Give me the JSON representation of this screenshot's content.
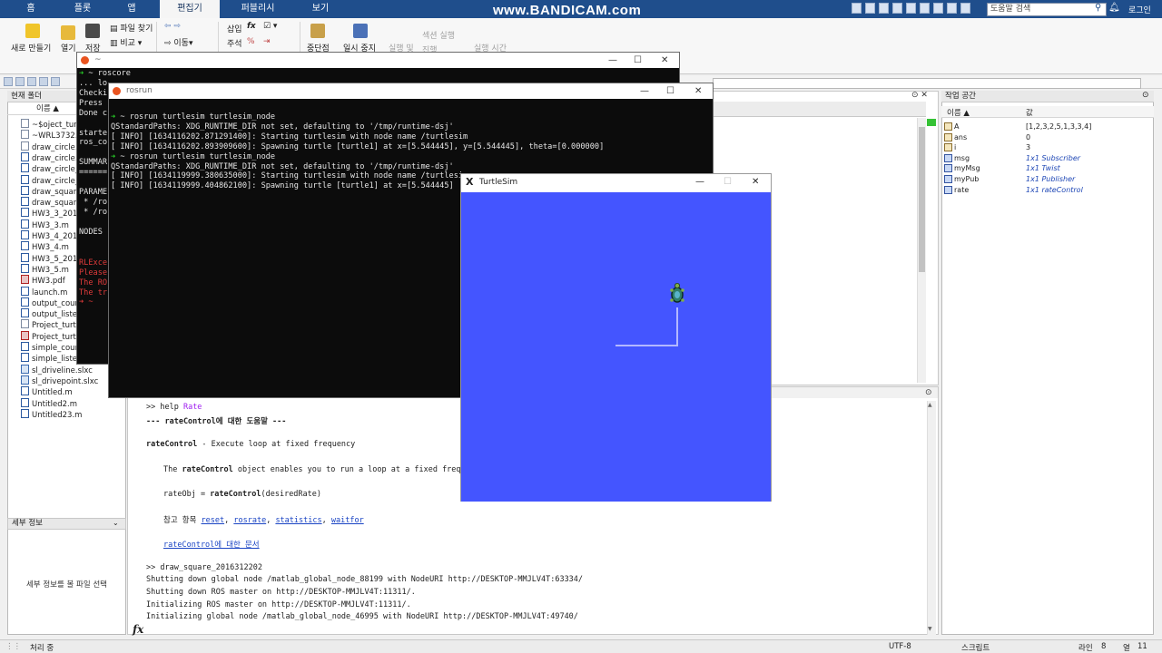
{
  "matlab": {
    "tabs": [
      "홈",
      "플롯",
      "앱",
      "편집기",
      "퍼블리시",
      "보기"
    ],
    "active_tab": "편집기",
    "search_placeholder": "도움말 검색",
    "login": "로그인",
    "ribbon": {
      "new": "새로 만들기",
      "open": "열기",
      "save": "저장",
      "find_files": "파일 찾기",
      "compare": "비교",
      "go": "이동",
      "insert": "삽입",
      "comment": "주석",
      "breakpoint": "중단점",
      "pause": "일시 중지",
      "run_and": "실행 및",
      "run_section": "섹션 실행",
      "step": "진행",
      "run_time": "실행 시간"
    },
    "current_folder": {
      "title": "현재 폴더",
      "col_name": "이름 ▲",
      "files": [
        {
          "name": "~$oject_turtle",
          "type": "doc"
        },
        {
          "name": "~WRL3732.tmp",
          "type": "doc"
        },
        {
          "name": "draw_circle.asv",
          "type": "doc"
        },
        {
          "name": "draw_circle.m",
          "type": "m"
        },
        {
          "name": "draw_circle_v",
          "type": "m"
        },
        {
          "name": "draw_circle_v",
          "type": "m"
        },
        {
          "name": "draw_square",
          "type": "m"
        },
        {
          "name": "draw_square",
          "type": "m"
        },
        {
          "name": "HW3_3_2016",
          "type": "m"
        },
        {
          "name": "HW3_3.m",
          "type": "m"
        },
        {
          "name": "HW3_4_2016",
          "type": "m"
        },
        {
          "name": "HW3_4.m",
          "type": "m"
        },
        {
          "name": "HW3_5_2016",
          "type": "m"
        },
        {
          "name": "HW3_5.m",
          "type": "m"
        },
        {
          "name": "HW3.pdf",
          "type": "pdf"
        },
        {
          "name": "launch.m",
          "type": "m"
        },
        {
          "name": "output_count",
          "type": "m"
        },
        {
          "name": "output_listen",
          "type": "m"
        },
        {
          "name": "Project_turtle",
          "type": "doc"
        },
        {
          "name": "Project_turtle",
          "type": "pdf"
        },
        {
          "name": "simple_count",
          "type": "m"
        },
        {
          "name": "simple_listen",
          "type": "m"
        },
        {
          "name": "sl_driveline.slxc",
          "type": "slx"
        },
        {
          "name": "sl_drivepoint.slxc",
          "type": "slx"
        },
        {
          "name": "Untitled.m",
          "type": "m"
        },
        {
          "name": "Untitled2.m",
          "type": "m"
        },
        {
          "name": "Untitled23.m",
          "type": "m"
        }
      ]
    },
    "details": {
      "title": "세부 정보",
      "hint": "세부 정보를 볼 파일 선택"
    },
    "command_window": {
      "l1_prompt": ">> help ",
      "l1_arg": "Rate",
      "l2": "--- rateControl에 대한 도움말 ---",
      "l3_bold": "rateControl",
      "l3_rest": " - Execute loop at fixed frequency",
      "l4_pre": "The ",
      "l4_bold": "rateControl",
      "l4_rest": " object enables you to run a loop at a fixed frequenc",
      "l5_pre": "rateObj = ",
      "l5_bold": "rateControl",
      "l5_rest": "(desiredRate)",
      "l6_pre": "참고 항목 ",
      "l6_links": [
        "reset",
        "rosrate",
        "statistics",
        "waitfor"
      ],
      "l7_link": "rateControl에 대한 문서",
      "l8": ">> draw_square_2016312202",
      "l9": "Shutting down global node /matlab_global_node_88199 with NodeURI http://DESKTOP-MMJLV4T:63334/",
      "l10": "Shutting down ROS master on http://DESKTOP-MMJLV4T:11311/.",
      "l11": "Initializing ROS master on http://DESKTOP-MMJLV4T:11311/.",
      "l12": "Initializing global node /matlab_global_node_46995 with NodeURI http://DESKTOP-MMJLV4T:49740/",
      "fx": "fx"
    },
    "workspace": {
      "title": "작업 공간",
      "col_name": "이름 ▲",
      "col_value": "값",
      "vars": [
        {
          "name": "A",
          "value": "[1,2,3,2,5,1,3,3,4]",
          "kind": "num"
        },
        {
          "name": "ans",
          "value": "0",
          "kind": "num"
        },
        {
          "name": "i",
          "value": "3",
          "kind": "num"
        },
        {
          "name": "msg",
          "value": "1x1 Subscriber",
          "kind": "obj"
        },
        {
          "name": "myMsg",
          "value": "1x1 Twist",
          "kind": "obj"
        },
        {
          "name": "myPub",
          "value": "1x1 Publisher",
          "kind": "obj"
        },
        {
          "name": "rate",
          "value": "1x1 rateControl",
          "kind": "obj"
        }
      ]
    },
    "status": {
      "left": "처리 중",
      "encoding": "UTF-8",
      "type": "스크립트",
      "line_label": "라인",
      "line": "8",
      "col_label": "열",
      "col": "11"
    }
  },
  "watermark": "www.BANDICAM.com",
  "terminal_roscore": {
    "title": "~",
    "prompt_sym": "➜",
    "cmd": " ~ roscore",
    "lines": [
      "... lo",
      "Checki",
      "Press ",
      "Done c",
      "",
      "starte",
      "ros_co",
      "",
      "SUMMAR",
      "======",
      "",
      "PARAME",
      " * /ro",
      " * /ro",
      "",
      "NODES"
    ],
    "red_lines": [
      "RLExce",
      "Please",
      "The RO",
      "The tr"
    ],
    "last_prompt": "➜ ~"
  },
  "terminal_rosrun": {
    "title": "rosrun",
    "lines": [
      {
        "t": "➜ ~ rosrun turtlesim turtlesim_node",
        "c": "p"
      },
      {
        "t": "QStandardPaths: XDG_RUNTIME_DIR not set, defaulting to '/tmp/runtime-dsj'",
        "c": ""
      },
      {
        "t": "[ INFO] [1634116202.871291400]: Starting turtlesim with node name /turtlesim",
        "c": ""
      },
      {
        "t": "[ INFO] [1634116202.893909600]: Spawning turtle [turtle1] at x=[5.544445], y=[5.544445], theta=[0.000000]",
        "c": ""
      },
      {
        "t": "➜ ~ rosrun turtlesim turtlesim_node",
        "c": "p"
      },
      {
        "t": "QStandardPaths: XDG_RUNTIME_DIR not set, defaulting to '/tmp/runtime-dsj'",
        "c": ""
      },
      {
        "t": "[ INFO] [1634119999.380635000]: Starting turtlesim with node name /turtlesim",
        "c": ""
      },
      {
        "t": "[ INFO] [1634119999.404862100]: Spawning turtle [turtle1] at x=[5.544445]",
        "c": ""
      }
    ]
  },
  "turtlesim": {
    "title": "TurtleSim",
    "background": "#4455ff",
    "path_color": "#b3b8ff"
  }
}
